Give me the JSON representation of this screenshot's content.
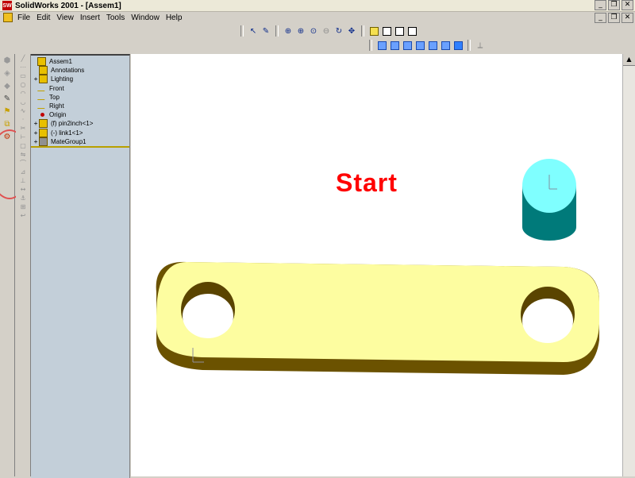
{
  "window": {
    "title": "SolidWorks 2001 - [Assem1]",
    "app_icon": "SW",
    "controls": [
      "_",
      "❐",
      "✕"
    ]
  },
  "menubar": {
    "items": [
      "File",
      "Edit",
      "View",
      "Insert",
      "Tools",
      "Window",
      "Help"
    ],
    "doc_controls": [
      "_",
      "❐",
      "✕"
    ]
  },
  "toolbar_view": {
    "icons": [
      "select-icon",
      "sketch-icon",
      "zoom-fit-icon",
      "zoom-in-icon",
      "zoom-area-icon",
      "zoom-prev-icon",
      "rotate-icon",
      "pan-icon",
      "shaded-cube-icon",
      "wireframe-cube-icon",
      "hidden-lines-cube-icon",
      "hidden-removed-cube-icon"
    ]
  },
  "toolbar_standard_views": {
    "icons": [
      "front-view-icon",
      "back-view-icon",
      "left-view-icon",
      "right-view-icon",
      "top-view-icon",
      "bottom-view-icon",
      "isometric-view-icon",
      "normal-to-icon"
    ]
  },
  "feature_tree": {
    "items": [
      {
        "label": "Assem1",
        "expand": "",
        "indent": 0,
        "icon": "assembly-icon",
        "color": "#e8c000"
      },
      {
        "label": "Annotations",
        "expand": "",
        "indent": 1,
        "icon": "annotations-icon",
        "color": "#e8c000"
      },
      {
        "label": "Lighting",
        "expand": "+",
        "indent": 1,
        "icon": "lighting-icon",
        "color": "#e8c000"
      },
      {
        "label": "Front",
        "expand": "",
        "indent": 1,
        "icon": "plane-icon",
        "color": "#c0a000"
      },
      {
        "label": "Top",
        "expand": "",
        "indent": 1,
        "icon": "plane-icon",
        "color": "#c0a000"
      },
      {
        "label": "Right",
        "expand": "",
        "indent": 1,
        "icon": "plane-icon",
        "color": "#c0a000"
      },
      {
        "label": "Origin",
        "expand": "",
        "indent": 1,
        "icon": "origin-icon",
        "color": "#c00000"
      },
      {
        "label": "(f) pin2inch<1>",
        "expand": "+",
        "indent": 1,
        "icon": "part-icon",
        "color": "#e8c000"
      },
      {
        "label": "(-) link1<1>",
        "expand": "+",
        "indent": 1,
        "icon": "part-icon",
        "color": "#e8c000"
      },
      {
        "label": "MateGroup1",
        "expand": "+",
        "indent": 1,
        "icon": "mategroup-icon",
        "color": "#909090"
      }
    ]
  },
  "viewport": {
    "caption": "Start",
    "caption_color": "#ff0000",
    "link_color": "#fdfda0",
    "link_shadow_color": "#6b5200",
    "pin_top_color": "#7fffff",
    "pin_side_color": "#007a7a"
  }
}
